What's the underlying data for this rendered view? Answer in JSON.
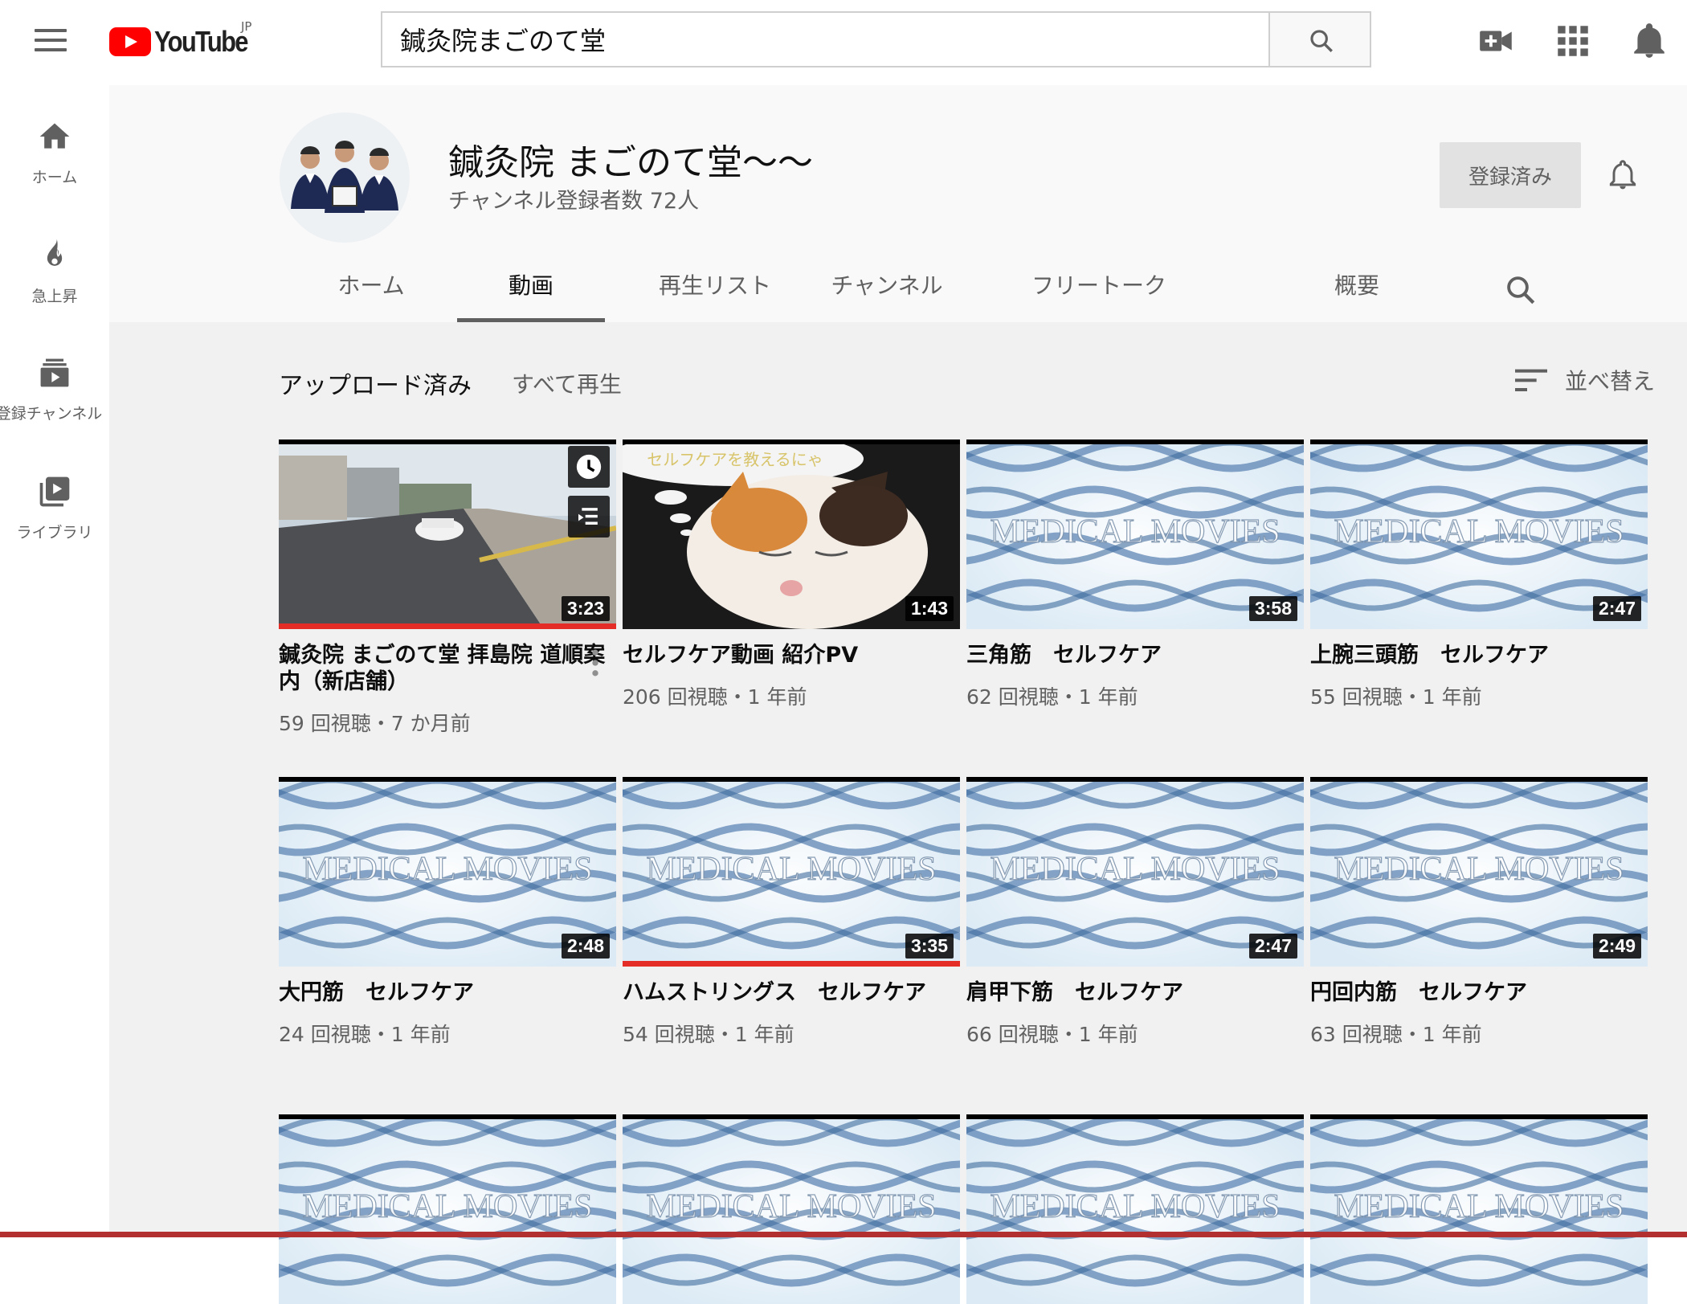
{
  "topbar": {
    "logo_text": "YouTube",
    "region": "JP",
    "search_value": "鍼灸院まごのて堂",
    "search_placeholder": "検索"
  },
  "sidebar": {
    "items": [
      {
        "label": "ホーム",
        "icon": "home-icon"
      },
      {
        "label": "急上昇",
        "icon": "flame-icon"
      },
      {
        "label": "登録チャンネル",
        "icon": "subscriptions-icon"
      },
      {
        "label": "ライブラリ",
        "icon": "library-icon"
      }
    ]
  },
  "channel": {
    "title": "鍼灸院 まごのて堂〜〜",
    "subscribers": "チャンネル登録者数 72人",
    "subscribed_label": "登録済み"
  },
  "tabs": [
    {
      "label": "ホーム"
    },
    {
      "label": "動画"
    },
    {
      "label": "再生リスト"
    },
    {
      "label": "チャンネル"
    },
    {
      "label": "フリートーク"
    },
    {
      "label": "概要"
    }
  ],
  "section": {
    "title": "アップロード済み",
    "play_all": "すべて再生",
    "sort": "並べ替え"
  },
  "videos": [
    {
      "title": "鍼灸院 まごのて堂 拝島院 道順案内（新店舗）",
      "meta": "59 回視聴・7 か月前",
      "duration": "3:23",
      "thumb": "street",
      "watched": 1.0
    },
    {
      "title": "セルフケア動画 紹介PV",
      "meta": "206 回視聴・1 年前",
      "duration": "1:43",
      "thumb": "cat",
      "thumb_caption": "セルフケアを教えるにゃ",
      "watched": 0
    },
    {
      "title": "三角筋　セルフケア",
      "meta": "62 回視聴・1 年前",
      "duration": "3:58",
      "thumb": "medical",
      "watched": 0
    },
    {
      "title": "上腕三頭筋　セルフケア",
      "meta": "55 回視聴・1 年前",
      "duration": "2:47",
      "thumb": "medical",
      "watched": 0
    },
    {
      "title": "大円筋　セルフケア",
      "meta": "24 回視聴・1 年前",
      "duration": "2:48",
      "thumb": "medical",
      "watched": 0
    },
    {
      "title": "ハムストリングス　セルフケア",
      "meta": "54 回視聴・1 年前",
      "duration": "3:35",
      "thumb": "medical",
      "watched": 1.0
    },
    {
      "title": "肩甲下筋　セルフケア",
      "meta": "66 回視聴・1 年前",
      "duration": "2:47",
      "thumb": "medical",
      "watched": 0
    },
    {
      "title": "円回内筋　セルフケア",
      "meta": "63 回視聴・1 年前",
      "duration": "2:49",
      "thumb": "medical",
      "watched": 0
    },
    {
      "thumb": "medical"
    },
    {
      "thumb": "medical"
    },
    {
      "thumb": "medical"
    },
    {
      "thumb": "medical"
    }
  ],
  "thumb_overlay_text": "MEDICAL MOVIES",
  "colors": {
    "accent": "#ff0000",
    "progress": "#e52d27",
    "text_secondary": "#606060",
    "content_bg": "#f1f1f1"
  }
}
